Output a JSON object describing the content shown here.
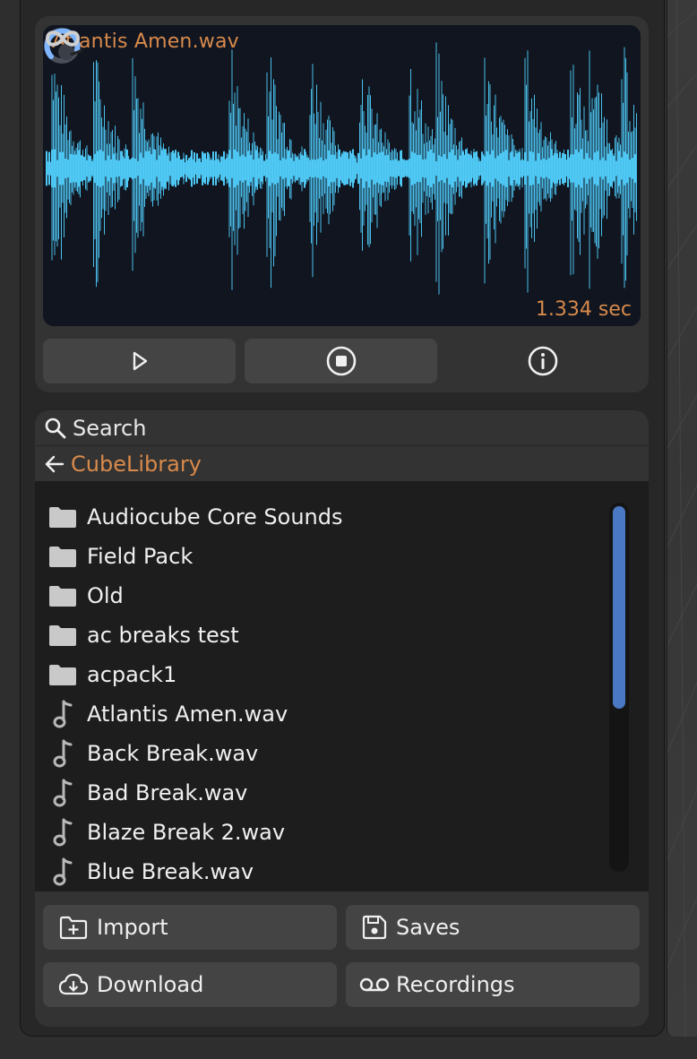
{
  "player": {
    "file_title": "Atlantis Amen.wav",
    "duration": "1.334 sec",
    "waveform_color": "#4fc9f5",
    "controls": [
      {
        "name": "play-button",
        "icon": "play-icon"
      },
      {
        "name": "stop-button",
        "icon": "stop-icon"
      },
      {
        "name": "info-button",
        "icon": "info-icon"
      }
    ]
  },
  "browser": {
    "search_label": "Search",
    "path_label": "CubeLibrary",
    "items": [
      {
        "type": "folder",
        "label": "Audiocube Core Sounds"
      },
      {
        "type": "folder",
        "label": "Field Pack"
      },
      {
        "type": "folder",
        "label": "Old"
      },
      {
        "type": "folder",
        "label": "ac breaks test"
      },
      {
        "type": "folder",
        "label": "acpack1"
      },
      {
        "type": "file",
        "label": "Atlantis Amen.wav"
      },
      {
        "type": "file",
        "label": "Back Break.wav"
      },
      {
        "type": "file",
        "label": "Bad Break.wav"
      },
      {
        "type": "file",
        "label": "Blaze Break 2.wav"
      },
      {
        "type": "file",
        "label": "Blue Break.wav"
      }
    ]
  },
  "buttons": {
    "import": "Import",
    "saves": "Saves",
    "download": "Download",
    "recordings": "Recordings"
  },
  "colors": {
    "accent": "#d98a4b",
    "scrollbar": "#4a78c2",
    "panel": "#333333"
  }
}
